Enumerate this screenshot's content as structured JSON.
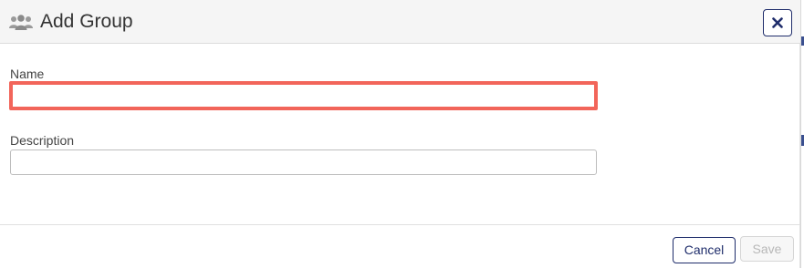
{
  "dialog": {
    "title": "Add Group",
    "title_icon": "users-icon",
    "close_icon": "close-icon"
  },
  "form": {
    "name": {
      "label": "Name",
      "value": "",
      "state": "invalid"
    },
    "description": {
      "label": "Description",
      "value": ""
    }
  },
  "footer": {
    "cancel_label": "Cancel",
    "save_label": "Save",
    "save_enabled": false
  },
  "colors": {
    "primary": "#1f2d6b",
    "error_border": "#f2655a",
    "header_bg": "#f5f5f5"
  }
}
